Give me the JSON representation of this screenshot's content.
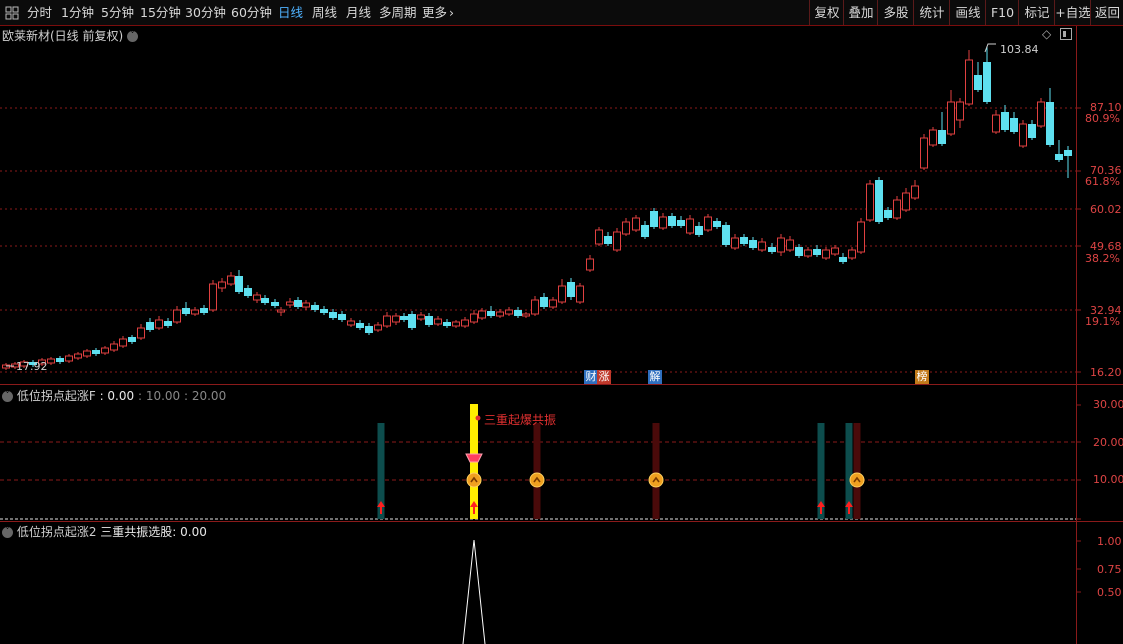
{
  "toolbar": {
    "grid_icon": "grid-icon",
    "periods": [
      "分时",
      "1分钟",
      "5分钟",
      "15分钟",
      "30分钟",
      "60分钟",
      "日线",
      "周线",
      "月线",
      "多周期",
      "更多"
    ],
    "active_period": "日线",
    "right_buttons": [
      "复权",
      "叠加",
      "多股",
      "统计",
      "画线",
      "F10",
      "+自选",
      "返回"
    ]
  },
  "main_pane": {
    "title": "欧莱新材(日线 前复权)",
    "high_label": "103.84",
    "low_label": "17.92",
    "price_axis": [
      "87.10",
      "70.36",
      "60.02",
      "49.68",
      "32.94",
      "16.20"
    ],
    "pct_axis": [
      "80.9%",
      "61.8%",
      "38.2%",
      "19.1%"
    ],
    "event_markers": [
      {
        "text": "财",
        "color": "#2f6fbf"
      },
      {
        "text": "涨",
        "color": "#c0392b"
      },
      {
        "text": "解",
        "color": "#2f6fbf"
      },
      {
        "text": "榜",
        "color": "#c27a1a"
      }
    ],
    "colors": {
      "up": "#e04040",
      "down": "#5ee0f0",
      "grid": "#8a1a1a"
    }
  },
  "indicator1": {
    "name": "低位拐点起涨F",
    "value": ": 0.00",
    "params": ": 10.00 : 20.00",
    "axis": [
      "30.00",
      "20.00",
      "10.00"
    ],
    "annotation": "三重起爆共振"
  },
  "indicator2": {
    "name": "低位拐点起涨2",
    "value_label": "三重共振选股: 0.00",
    "axis": [
      "1.00",
      "0.75",
      "0.50"
    ]
  }
}
